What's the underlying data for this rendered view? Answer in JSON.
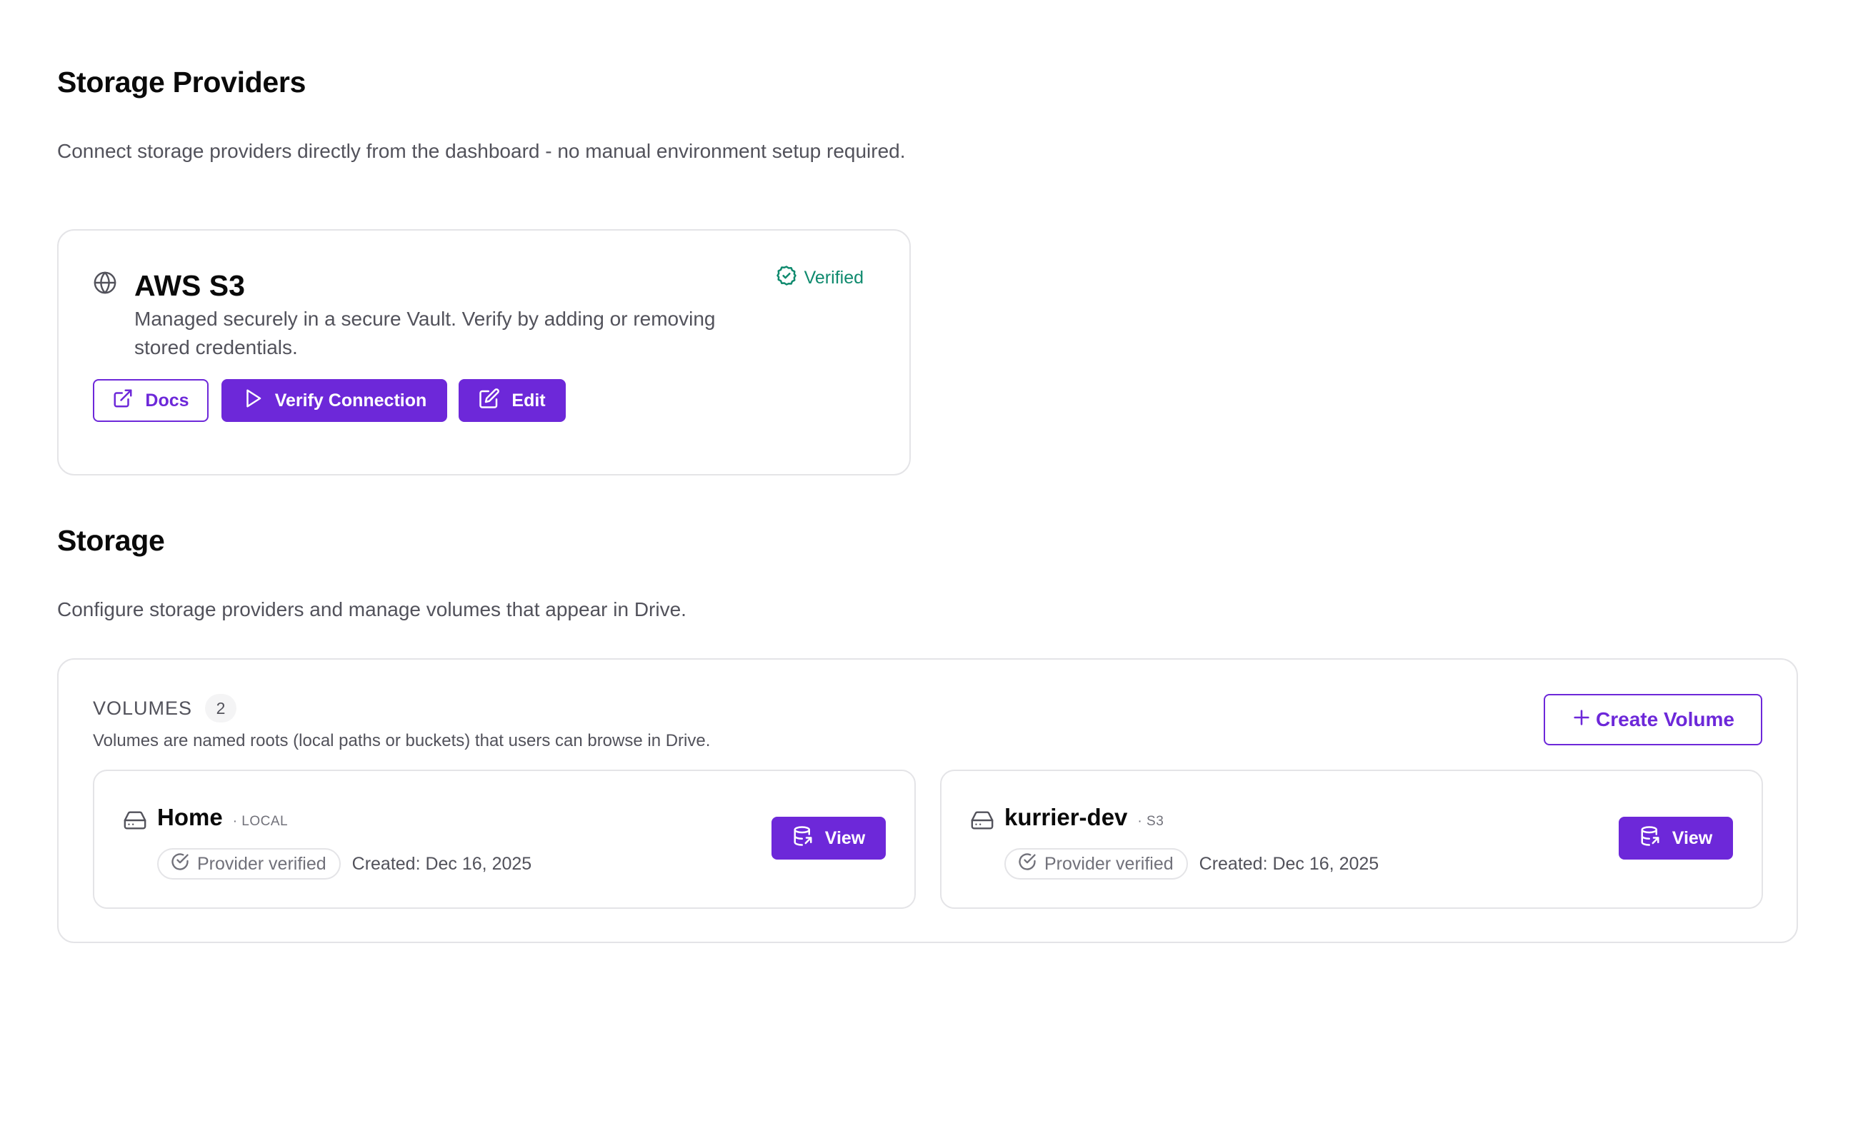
{
  "providers": {
    "title": "Storage Providers",
    "description": "Connect storage providers directly from the dashboard - no manual environment setup required.",
    "card": {
      "icon": "globe-icon",
      "name": "AWS S3",
      "status": "Verified",
      "description": "Managed securely in a secure Vault. Verify by adding or removing stored credentials.",
      "buttons": {
        "docs": "Docs",
        "verify": "Verify Connection",
        "edit": "Edit"
      }
    }
  },
  "storage": {
    "title": "Storage",
    "description": "Configure storage providers and manage volumes that appear in Drive.",
    "volumes": {
      "label": "VOLUMES",
      "count": "2",
      "description": "Volumes are named roots (local paths or buckets) that users can browse in Drive.",
      "create_label": "Create Volume",
      "items": [
        {
          "name": "Home",
          "type": "· LOCAL",
          "status": "Provider verified",
          "created": "Created: Dec 16, 2025",
          "action": "View"
        },
        {
          "name": "kurrier-dev",
          "type": "· S3",
          "status": "Provider verified",
          "created": "Created: Dec 16, 2025",
          "action": "View"
        }
      ]
    }
  },
  "colors": {
    "accent": "#6d28d9",
    "success": "#0f8a6e",
    "border": "#e4e4e7",
    "muted_text": "#52525b"
  }
}
